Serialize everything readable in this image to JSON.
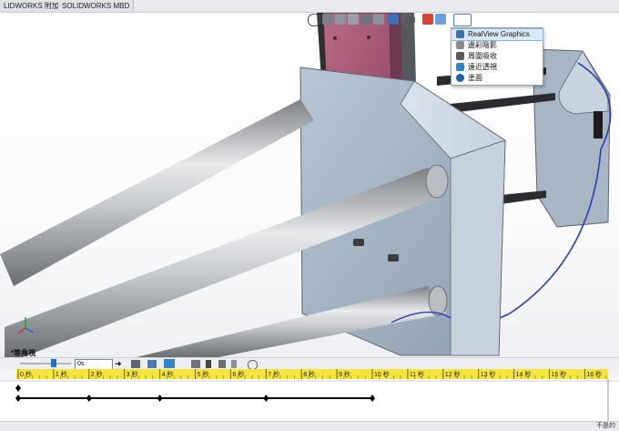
{
  "tabs": [
    "LIDWORKS 附加程式",
    "SOLIDWORKS MBD"
  ],
  "view": {
    "orientation_label": "*等角視"
  },
  "render_menu": {
    "items": [
      {
        "label": "RealView Graphics",
        "icon": "realview-icon",
        "color": "#3a6fb0",
        "selected": true
      },
      {
        "label": "邊彩陰影",
        "icon": "shadows-icon",
        "color": "#8a8a8a"
      },
      {
        "label": "周圍吸收",
        "icon": "ambient-occlusion-icon",
        "color": "#5a5a5a"
      },
      {
        "label": "遠近透視",
        "icon": "perspective-icon",
        "color": "#2f86c8"
      },
      {
        "label": "塗面",
        "icon": "cartoon-icon",
        "color": "#1a5fa8"
      }
    ]
  },
  "timeline": {
    "units": "秒",
    "ticks": [
      "0 秒",
      "1 秒",
      "2 秒",
      "3 秒",
      "4 秒",
      "5 秒",
      "6 秒",
      "7 秒",
      "8 秒",
      "9 秒",
      "10 秒",
      "11 秒",
      "12 秒",
      "13 秒",
      "14 秒",
      "15 秒",
      "16 秒"
    ],
    "time_field": "0s",
    "keyframes_seconds": [
      0,
      2,
      4,
      7,
      10
    ]
  },
  "status": {
    "right_text": "不是的"
  },
  "colors": {
    "ruler": "#f5e43b",
    "accent": "#1f74c7"
  }
}
